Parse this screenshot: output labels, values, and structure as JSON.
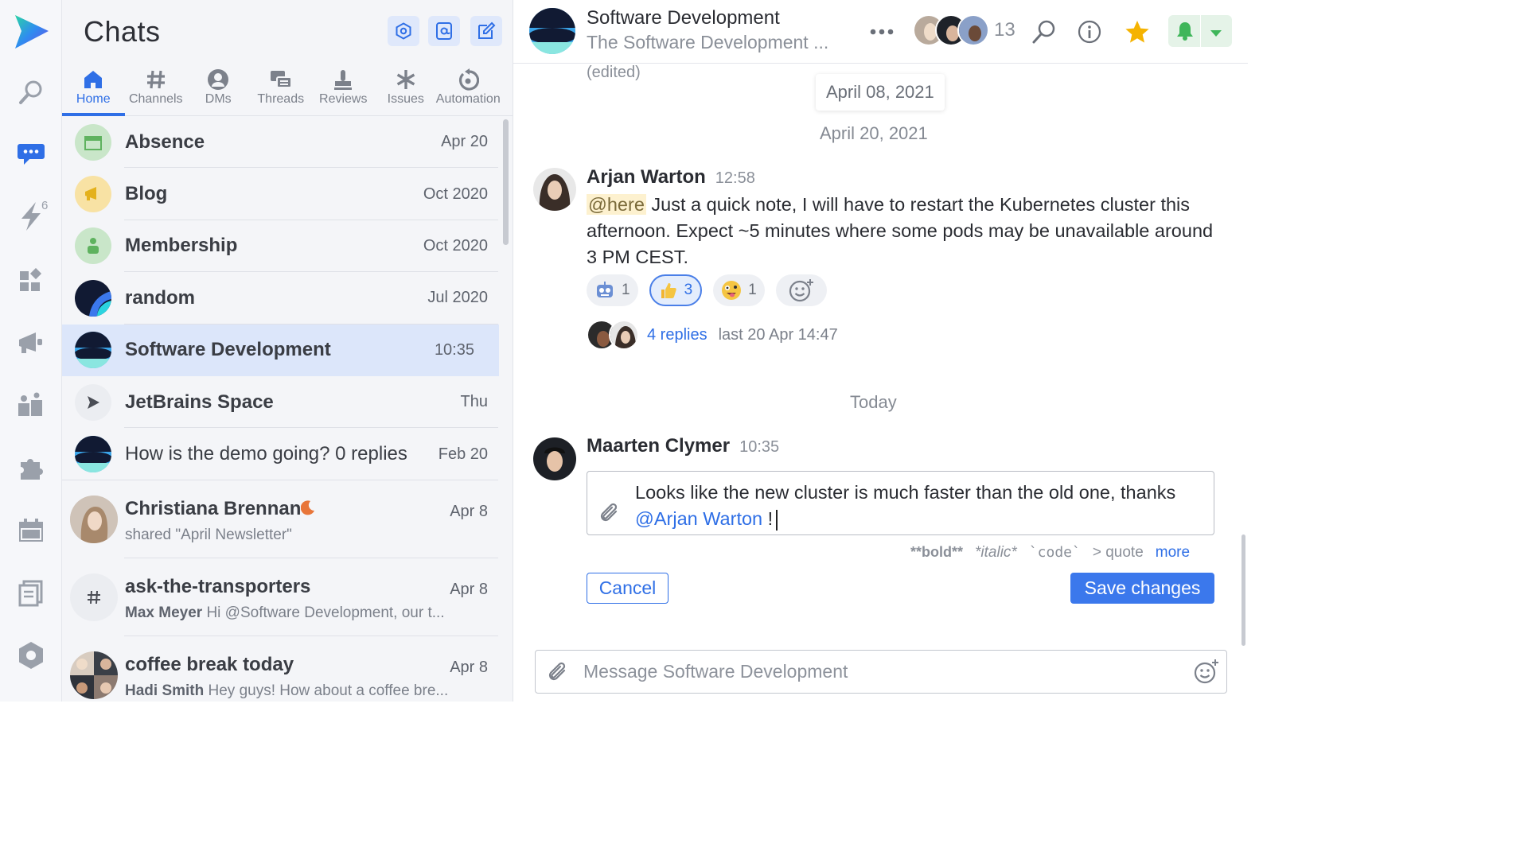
{
  "rail": {
    "badge": "6"
  },
  "list": {
    "title": "Chats",
    "tabs": [
      {
        "label": "Home"
      },
      {
        "label": "Channels"
      },
      {
        "label": "DMs"
      },
      {
        "label": "Threads"
      },
      {
        "label": "Reviews"
      },
      {
        "label": "Issues"
      },
      {
        "label": "Automation"
      }
    ],
    "rows": [
      {
        "name": "Absence",
        "date": "Apr 20"
      },
      {
        "name": "Blog",
        "date": "Oct 2020"
      },
      {
        "name": "Membership",
        "date": "Oct 2020"
      },
      {
        "name": "random",
        "date": "Jul 2020"
      },
      {
        "name": "Software Development",
        "date": "10:35"
      },
      {
        "name": "JetBrains Space",
        "date": "Thu"
      },
      {
        "name": "How is the demo going? 0 replies",
        "date": "Feb 20"
      }
    ],
    "rich_rows": [
      {
        "name": "Christiana Brennan",
        "date": "Apr 8",
        "sub": "shared \"April Newsletter\"",
        "sub_author": ""
      },
      {
        "name": "ask-the-transporters",
        "date": "Apr 8",
        "sub_author": "Max Meyer",
        "sub": " Hi @Software Development, our t..."
      },
      {
        "name": "coffee break today",
        "date": "Apr 8",
        "sub_author": "Hadi Smith",
        "sub": " Hey guys! How about a coffee bre..."
      }
    ]
  },
  "channel": {
    "title": "Software Development",
    "description": "The Software Development ...",
    "member_count": "13"
  },
  "messages": {
    "edited_note": "(edited)",
    "date_pill": "April 08, 2021",
    "date_sep_1": "April 20, 2021",
    "msg1": {
      "author": "Arjan Warton",
      "time": "12:58",
      "mention": "@here",
      "text": " Just a quick note, I will have to restart the Kubernetes cluster this afternoon. Expect ~5 minutes where some pods may be unavailable around 3 PM CEST.",
      "reactions": [
        {
          "count": "1"
        },
        {
          "count": "3"
        },
        {
          "count": "1"
        }
      ],
      "replies_link": "4 replies",
      "replies_last": "last 20 Apr 14:47"
    },
    "date_sep_2": "Today",
    "msg2": {
      "author": "Maarten Clymer",
      "time": "10:35",
      "edit_text": "Looks like the new cluster is much faster than the old one, thanks ",
      "edit_mention": "@Arjan Warton",
      "edit_tail": " !"
    }
  },
  "editor": {
    "fmt_bold": "**bold**",
    "fmt_italic": "*italic*",
    "fmt_code": "`code`",
    "fmt_quote": "> quote",
    "fmt_more": "more",
    "cancel": "Cancel",
    "save": "Save changes"
  },
  "composer": {
    "placeholder": "Message Software Development"
  },
  "colors": {
    "accent": "#2f6fe6",
    "selected_row": "#dce6fa",
    "star": "#f5b301",
    "bell": "#3fb65a"
  }
}
